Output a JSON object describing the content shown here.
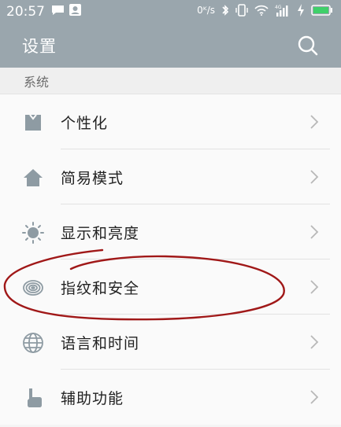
{
  "status_bar": {
    "time": "20:57",
    "net_speed": "0ᴷ/s",
    "icons": [
      "chat-icon",
      "person-icon",
      "bluetooth-icon",
      "vibrate-icon",
      "wifi-icon",
      "signal-4g-icon",
      "charging-icon",
      "battery-icon"
    ]
  },
  "app_bar": {
    "title": "设置",
    "search_icon": "search-icon"
  },
  "section": {
    "label": "系统"
  },
  "items": [
    {
      "label": "个性化",
      "icon": "shirt-icon"
    },
    {
      "label": "简易模式",
      "icon": "home-icon"
    },
    {
      "label": "显示和亮度",
      "icon": "brightness-icon"
    },
    {
      "label": "指纹和安全",
      "icon": "fingerprint-icon"
    },
    {
      "label": "语言和时间",
      "icon": "globe-icon"
    },
    {
      "label": "辅助功能",
      "icon": "hand-icon"
    }
  ],
  "colors": {
    "header": "#9aa6ad",
    "icon": "#8e9ba3",
    "annotation": "#a01818"
  }
}
